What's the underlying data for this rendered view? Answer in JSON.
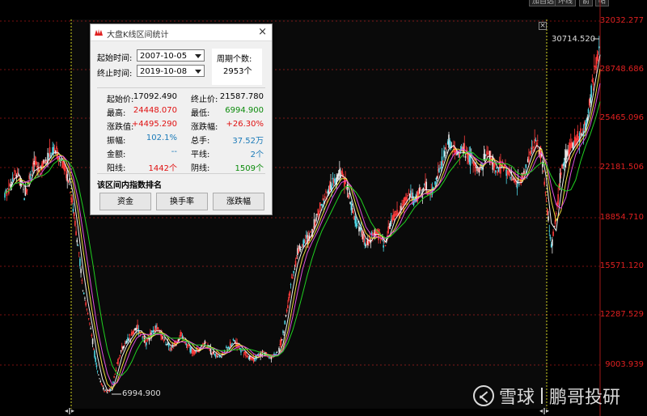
{
  "topbar": {
    "buttons": [
      "加自选",
      "环线",
      "箭",
      "帖"
    ]
  },
  "dialog": {
    "title": "大盘K线区间统计",
    "start_label": "起始时间:",
    "start_value": "2007-10-05",
    "end_label": "终止时间:",
    "end_value": "2019-10-08",
    "period_label": "周期个数:",
    "period_value": "2953个",
    "stats": [
      {
        "l1": "起始价:",
        "v1": "17092.490",
        "c1": "blk",
        "l2": "终止价:",
        "v2": "21587.780",
        "c2": "blk"
      },
      {
        "l1": "最高:",
        "v1": "24448.070",
        "c1": "red",
        "l2": "最低:",
        "v2": "6994.900",
        "c2": "green"
      },
      {
        "l1": "涨跌值:",
        "v1": "+4495.290",
        "c1": "red",
        "l2": "涨跌幅:",
        "v2": "+26.30%",
        "c2": "red"
      },
      {
        "l1": "振幅:",
        "v1": "102.1%",
        "c1": "blue",
        "l2": "总手:",
        "v2": "37.52万",
        "c2": "blue"
      },
      {
        "l1": "金额:",
        "v1": "--",
        "c1": "blue",
        "l2": "平线:",
        "v2": "2个",
        "c2": "blue"
      },
      {
        "l1": "阳线:",
        "v1": "1442个",
        "c1": "red",
        "l2": "阴线:",
        "v2": "1509个",
        "c2": "green"
      }
    ],
    "ranking_label": "该区间内指数排名",
    "buttons": [
      "资金",
      "换手率",
      "涨跌幅"
    ]
  },
  "chart": {
    "current_price": "30714.520",
    "low_annotation": "6994.900",
    "y_labels": [
      "32032.277",
      "28748.686",
      "25465.096",
      "22181.506",
      "18854.710",
      "15571.120",
      "12287.529",
      "9003.939"
    ]
  },
  "chart_data": {
    "type": "line",
    "series": [
      {
        "values": [
          20500,
          21000,
          22000,
          21500,
          20500,
          21500,
          22500,
          22000,
          22500,
          23000,
          23500,
          23000,
          22500,
          21500,
          19500,
          17000,
          14000,
          12500,
          10500,
          8500,
          7500,
          7000,
          7500,
          9000,
          10000,
          10500,
          11000,
          11500,
          11000,
          10500,
          11000,
          11500,
          11000,
          10500,
          10000,
          10500,
          11000,
          10500,
          10000,
          9800,
          10000,
          10500,
          10000,
          9700,
          9500,
          9800,
          10200,
          10600,
          10200,
          9800,
          9500,
          9300,
          9600,
          9800,
          9500,
          9500,
          9700,
          11000,
          13000,
          15000,
          16500,
          17000,
          17500,
          18000,
          19000,
          20000,
          20500,
          21000,
          21500,
          22000,
          21000,
          19500,
          18500,
          18000,
          17000,
          17500,
          18000,
          17500,
          17000,
          18500,
          19000,
          19500,
          20000,
          20500,
          20000,
          20500,
          21000,
          20500,
          21000,
          22000,
          23000,
          24000,
          23500,
          23000,
          23500,
          23000,
          22500,
          22000,
          22500,
          23500,
          22500,
          22000,
          22500,
          22000,
          21500,
          21000,
          21500,
          22500,
          23500,
          24000,
          23000,
          20000,
          17000,
          19000,
          22000,
          23000,
          23500,
          24000,
          24500,
          25000,
          27000,
          29000,
          30714.52
        ]
      }
    ],
    "ylim": [
      6000,
      33000
    ]
  }
}
